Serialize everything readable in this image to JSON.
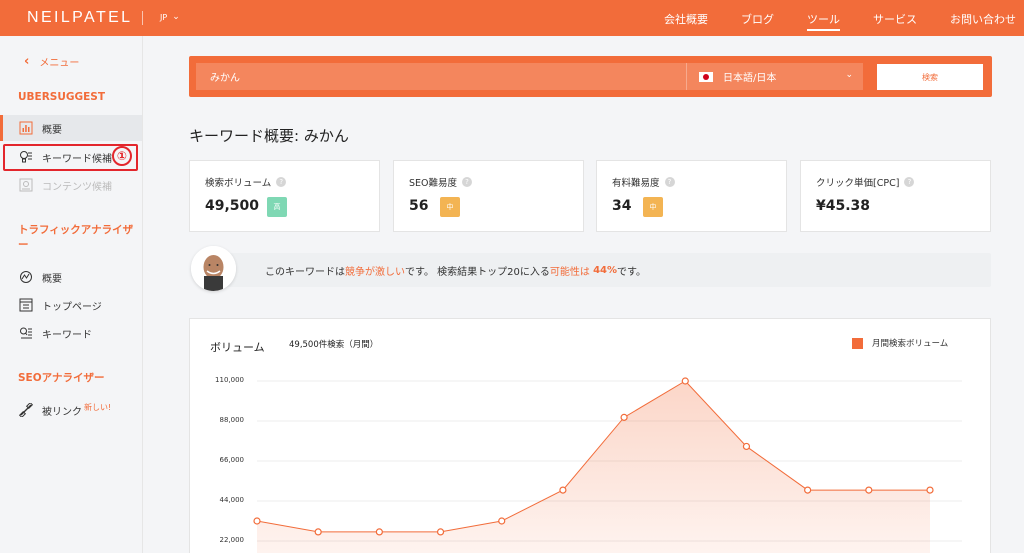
{
  "header": {
    "logo": "NEILPATEL",
    "lang": "JP",
    "nav": [
      "会社概要",
      "ブログ",
      "ツール",
      "サービス",
      "お問い合わせ"
    ],
    "active_nav": "ツール"
  },
  "sidebar": {
    "back_label": "メニュー",
    "sections": [
      {
        "title": "UBERSUGGEST"
      },
      {
        "title": "トラフィックアナライザー"
      },
      {
        "title": "SEOアナライザー"
      }
    ],
    "items": [
      {
        "label": "概要",
        "icon": "chart-icon"
      },
      {
        "label": "キーワード候補",
        "icon": "lightbulb-icon"
      },
      {
        "label": "コンテンツ候補",
        "icon": "content-icon"
      },
      {
        "label": "概要",
        "icon": "traffic-overview-icon"
      },
      {
        "label": "トップページ",
        "icon": "top-page-icon"
      },
      {
        "label": "キーワード",
        "icon": "keyword-search-icon"
      },
      {
        "label": "被リンク",
        "icon": "link-icon"
      }
    ],
    "new_tag": "新しい!",
    "annotation_number": "①"
  },
  "search": {
    "query": "みかん",
    "language": "日本語/日本",
    "button": "検索"
  },
  "page_title": "キーワード概要: みかん",
  "metrics": [
    {
      "label": "検索ボリューム",
      "value": "49,500",
      "badge": "高",
      "badge_color": "#7fd8b4"
    },
    {
      "label": "SEO難易度",
      "value": "56",
      "badge": "中",
      "badge_color": "#f3b453"
    },
    {
      "label": "有料難易度",
      "value": "34",
      "badge": "中",
      "badge_color": "#f3b453"
    },
    {
      "label": "クリック単価[CPC]",
      "value": "¥45.38"
    }
  ],
  "message": {
    "p1": "このキーワードは",
    "p2": "競争が激しい",
    "p3": "です。 検索結果トップ20に入る",
    "p4": "可能性は",
    "p5": "44%",
    "p6": "です。"
  },
  "chart_data": {
    "type": "area",
    "title": "ボリューム",
    "subtitle": "49,500件検索（月間）",
    "legend": [
      "月間検索ボリューム"
    ],
    "yticks": [
      "110,000",
      "88,000",
      "66,000",
      "44,000",
      "22,000"
    ],
    "ylim": [
      22000,
      110000
    ],
    "series": [
      {
        "name": "月間検索ボリューム",
        "values": [
          33000,
          27000,
          27000,
          27000,
          33000,
          50000,
          90000,
          110000,
          74000,
          50000,
          50000,
          50000
        ]
      }
    ],
    "color": "#f26c3a"
  }
}
